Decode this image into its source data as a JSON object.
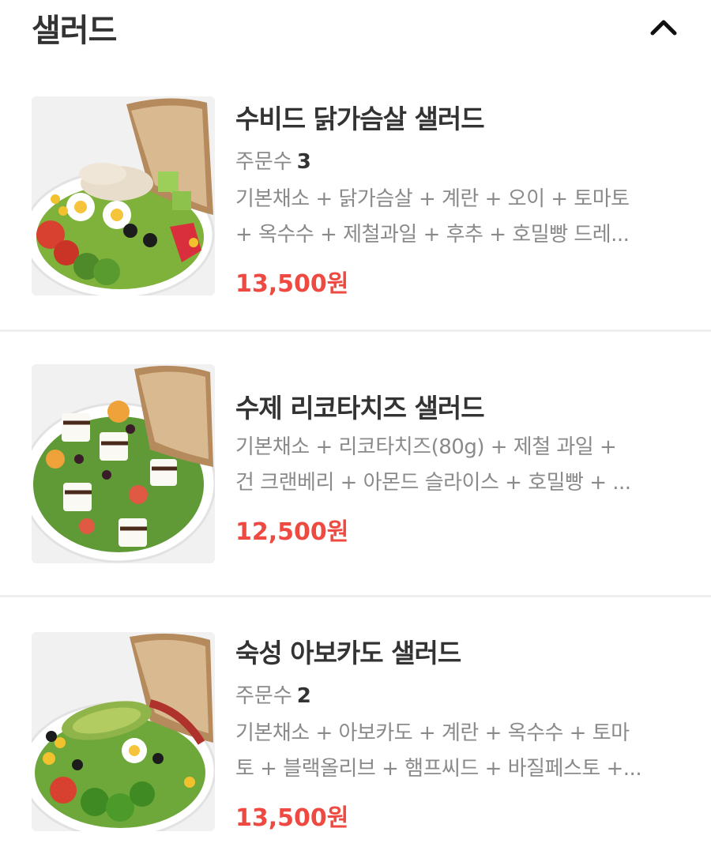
{
  "section": {
    "title": "샐러드",
    "collapse_icon": "chevron-up-icon"
  },
  "items": [
    {
      "name": "수비드 닭가슴살 샐러드",
      "orders_label": "주문수",
      "orders_count": "3",
      "desc_lines": [
        "기본채소 + 닭가슴살 + 계란 + 오이 + 토마토",
        "+ 옥수수 + 제철과일 + 후추 + 호밀빵 드레..."
      ],
      "price": "13,500원"
    },
    {
      "name": "수제 리코타치즈 샐러드",
      "desc_lines": [
        "기본채소 + 리코타치즈(80g) + 제철 과일 +",
        "건 크랜베리 + 아몬드 슬라이스 + 호밀빵 + ..."
      ],
      "price": "12,500원"
    },
    {
      "name": "숙성 아보카도 샐러드",
      "orders_label": "주문수",
      "orders_count": "2",
      "desc_lines": [
        "기본채소 + 아보카도 + 계란 + 옥수수 + 토마",
        "토 + 블랙올리브 + 햄프씨드 + 바질페스토 +..."
      ],
      "price": "13,500원"
    }
  ],
  "colors": {
    "price": "#ee4a41",
    "title": "#333333",
    "secondary": "#8a8a8a",
    "divider": "#eeeeee"
  }
}
